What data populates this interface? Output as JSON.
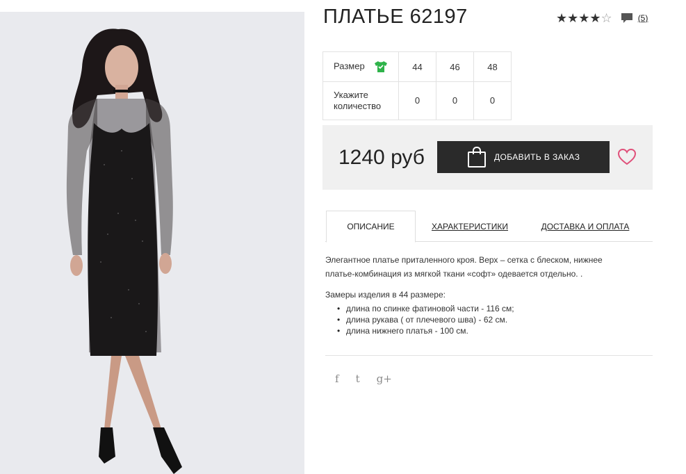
{
  "product": {
    "title": "ПЛАТЬЕ 62197",
    "rating": {
      "filled": "★★★★",
      "empty": "☆",
      "value": 4,
      "max": 5,
      "reviews_count": "(5)"
    }
  },
  "size_table": {
    "size_label": "Размер",
    "qty_label_line1": "Укажите",
    "qty_label_line2": "количество",
    "sizes": [
      "44",
      "46",
      "48"
    ],
    "quantities": [
      "0",
      "0",
      "0"
    ]
  },
  "buy": {
    "price": "1240 руб",
    "add_button": "ДОБАВИТЬ В ЗАКАЗ"
  },
  "tabs": {
    "description": "ОПИСАНИЕ",
    "characteristics": "ХАРАКТЕРИСТИКИ",
    "delivery": "ДОСТАВКА И ОПЛАТА"
  },
  "description": {
    "line1": "Элегантное платье приталенного кроя. Верх – сетка с блеском, нижнее",
    "line2": "платье-комбинация из мягкой ткани «софт» одевается отдельно. .",
    "measure_title": "Замеры изделия в 44 размере:",
    "measures": [
      "длина по спинке фатиновой части - 116 см;",
      "длина рукава ( от плечевого шва) - 62 см.",
      "длина нижнего платья - 100 см."
    ]
  },
  "social": {
    "facebook": "f",
    "twitter": "t",
    "google_plus": "g+"
  },
  "colors": {
    "button_bg": "#2a2a2a",
    "heart": "#e0507a",
    "tshirt_icon": "#2fb34a",
    "buybox_bg": "#f0f0f0",
    "photo_bg": "#e9eaee"
  },
  "icons": [
    "star-icon",
    "comment-icon",
    "tshirt-icon",
    "shopping-bag-icon",
    "heart-icon",
    "facebook-icon",
    "twitter-icon",
    "google-plus-icon"
  ]
}
